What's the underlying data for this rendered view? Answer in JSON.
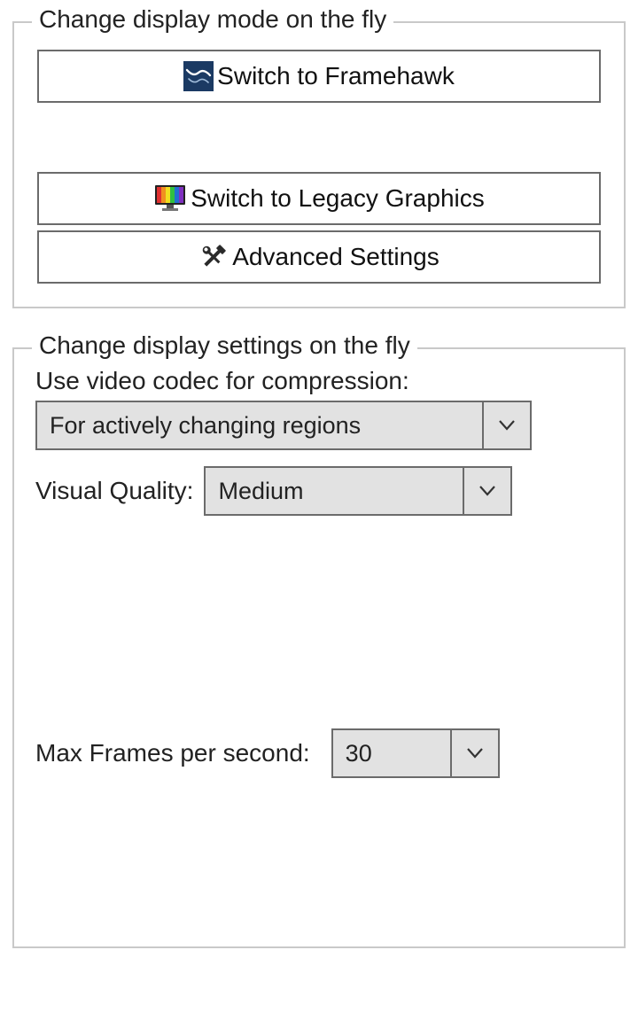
{
  "group_mode": {
    "title": "Change display mode on the fly",
    "buttons": {
      "framehawk": "Switch to Framehawk",
      "legacy": "Switch to Legacy Graphics",
      "advanced": "Advanced Settings"
    }
  },
  "group_settings": {
    "title": "Change display settings on the fly",
    "codec_label": "Use video codec for compression:",
    "codec_value": "For actively changing regions",
    "vq_label": "Visual Quality:",
    "vq_value": "Medium",
    "fps_label": "Max Frames per second:",
    "fps_value": "30"
  }
}
